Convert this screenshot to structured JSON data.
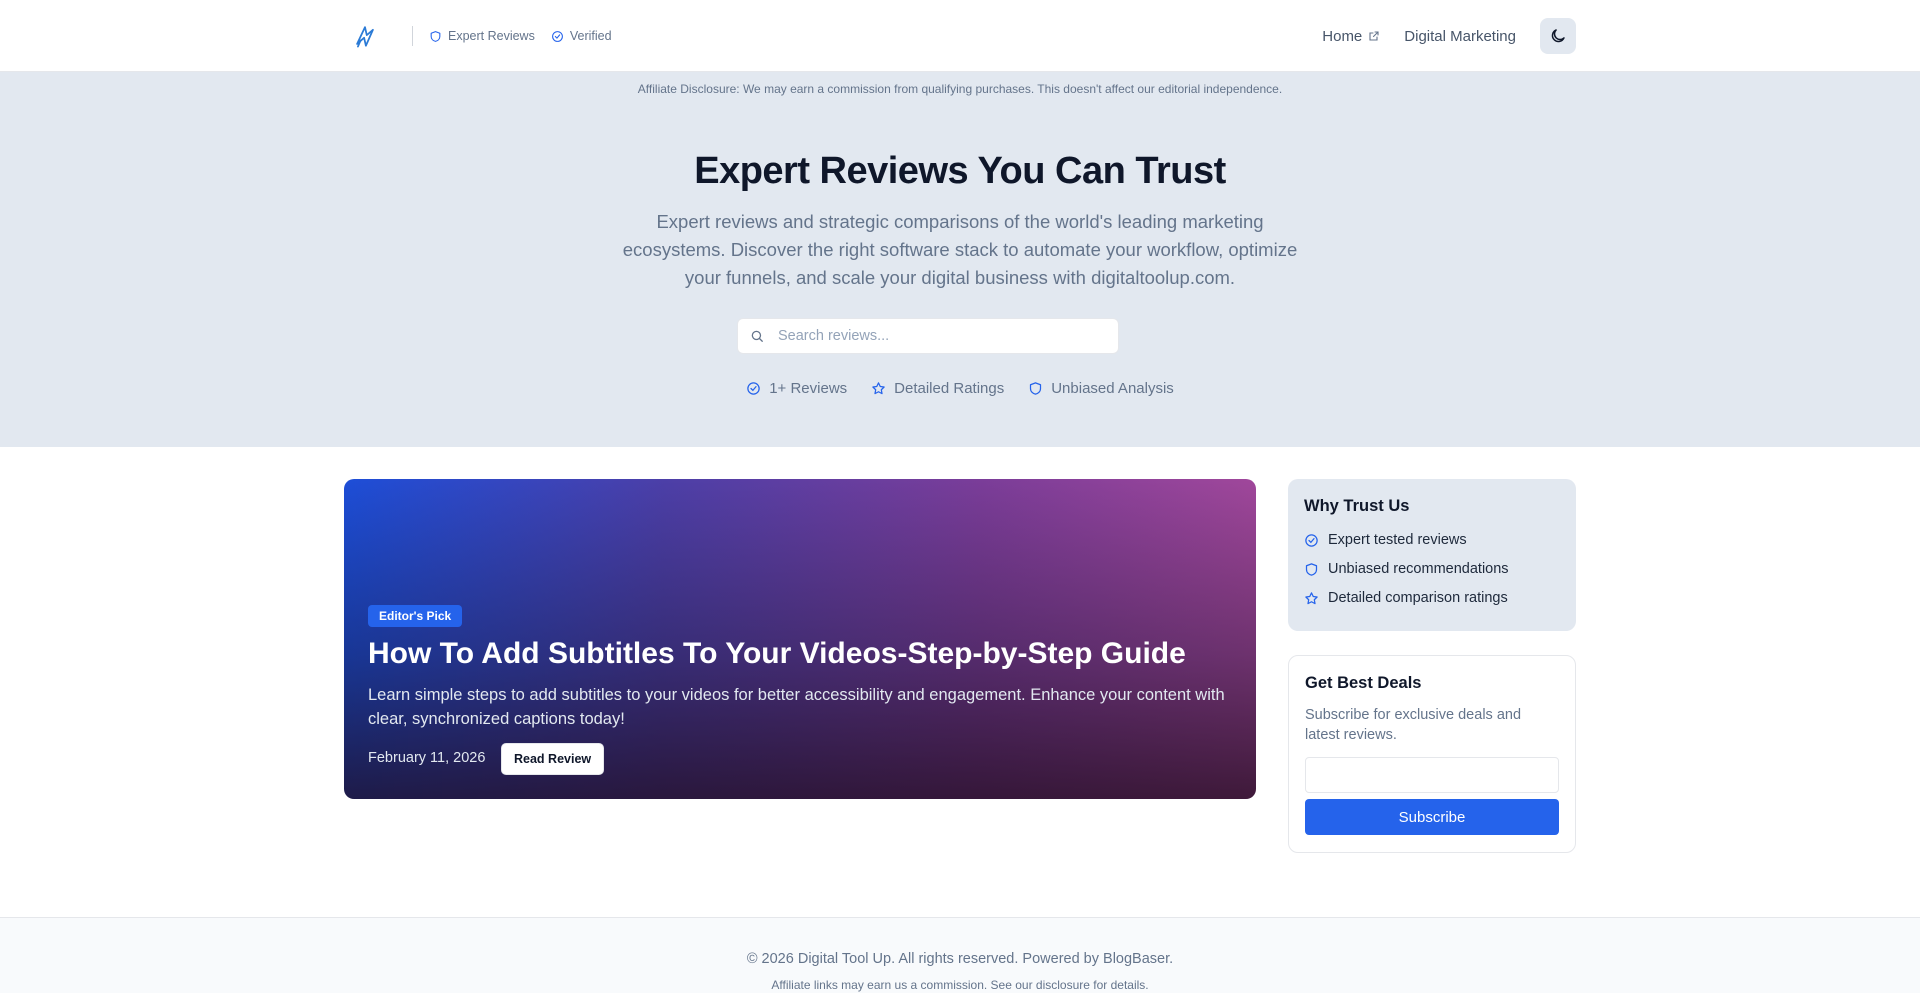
{
  "header": {
    "logo_icon": "lightning-rocket-icon",
    "badges": [
      {
        "label": "Expert Reviews",
        "icon": "shield-icon"
      },
      {
        "label": "Verified",
        "icon": "check-circle-icon"
      }
    ],
    "nav": [
      {
        "label": "Home",
        "icon": "external-link-icon"
      },
      {
        "label": "Digital Marketing"
      }
    ],
    "theme_toggle_icon": "moon-icon"
  },
  "hero": {
    "disclosure": "Affiliate Disclosure: We may earn a commission from qualifying purchases. This doesn't affect our editorial independence.",
    "title": "Expert Reviews You Can Trust",
    "subtitle": "Expert reviews and strategic comparisons of the world's leading marketing ecosystems. Discover the right software stack to automate your workflow, optimize your funnels, and scale your digital business with digitaltoolup.com.",
    "search_placeholder": "Search reviews...",
    "stats": [
      {
        "label": "1+ Reviews",
        "icon": "check-circle-icon"
      },
      {
        "label": "Detailed Ratings",
        "icon": "star-icon"
      },
      {
        "label": "Unbiased Analysis",
        "icon": "shield-icon"
      }
    ]
  },
  "featured": {
    "badge": "Editor's Pick",
    "title": "How To Add Subtitles To Your Videos-Step-by-Step Guide",
    "description": "Learn simple steps to add subtitles to your videos for better accessibility and engagement. Enhance your content with clear, synchronized captions today!",
    "date": "February 11, 2026",
    "button": "Read Review"
  },
  "sidebar": {
    "trust": {
      "title": "Why Trust Us",
      "items": [
        {
          "label": "Expert tested reviews",
          "icon": "check-circle-icon"
        },
        {
          "label": "Unbiased recommendations",
          "icon": "shield-icon"
        },
        {
          "label": "Detailed comparison ratings",
          "icon": "star-icon"
        }
      ]
    },
    "deals": {
      "title": "Get Best Deals",
      "subtitle": "Subscribe for exclusive deals and latest reviews.",
      "input_value": "",
      "button": "Subscribe"
    }
  },
  "footer": {
    "copyright": "© 2026 Digital Tool Up. All rights reserved. Powered by BlogBaser.",
    "note": "Affiliate links may earn us a commission. See our disclosure for details."
  },
  "colors": {
    "accent": "#2563eb",
    "hero_bg": "#e2e8f0",
    "text_dark": "#0f172a",
    "text_muted": "#64748b"
  }
}
